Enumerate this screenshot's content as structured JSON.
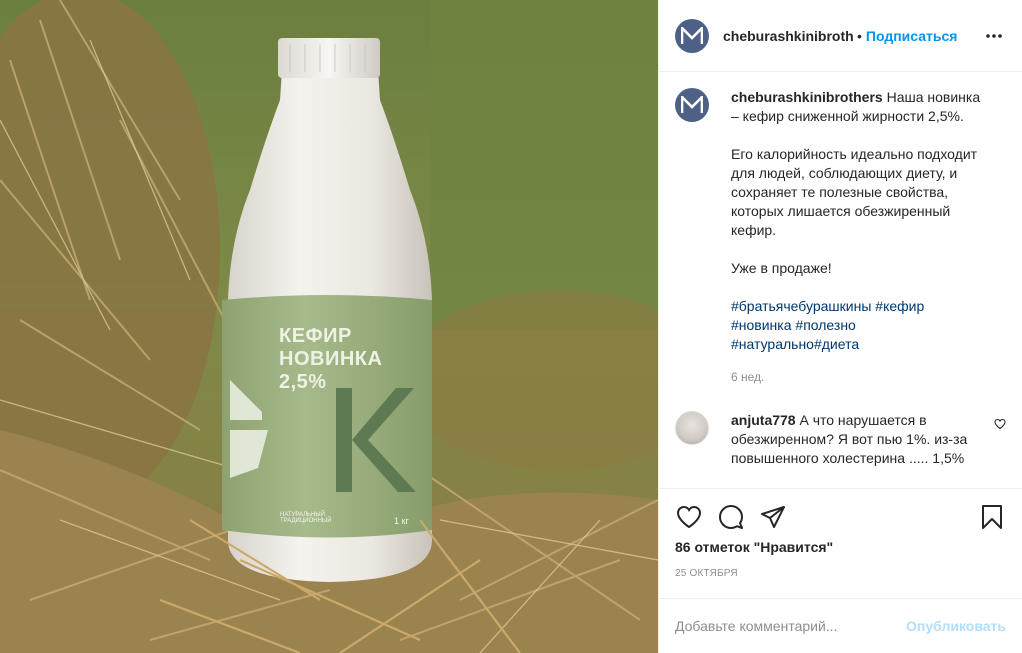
{
  "photo": {
    "alt_label": {
      "line1": "КЕФИР",
      "line2": "НОВИНКА",
      "line3": "2,5%",
      "weight": "1 кг",
      "small": "НАТУРАЛЬНЫЙ ТРАДИЦИОННЫЙ",
      "big_letter": "К"
    }
  },
  "header": {
    "username": "cheburashkinibrothers",
    "dot": "•",
    "follow_label": "Подписаться",
    "more_icon": "more-horizontal-icon"
  },
  "caption": {
    "username": "cheburashkinibrothers",
    "text1": "Наша новинка – кефир сниженной жирности 2,5%.",
    "text2": "Его калорийность идеально подходит для людей, соблюдающих диету, и сохраняет те полезные свойства, которых лишается обезжиренный кефир.",
    "text3": "Уже в продаже!",
    "hashtags": [
      "#братьячебурашкины",
      "#кефир",
      "#новинка",
      "#полезно",
      "#натурально",
      "#диета"
    ],
    "time": "6 нед."
  },
  "comment": {
    "username": "anjuta778",
    "text": "А что нарушается в обезжиренном? Я вот пью 1%. из-за повышенного холестерина ..... 1,5%"
  },
  "actions": {
    "likes": "86 отметок \"Нравится\"",
    "date": "25 октября",
    "icons": [
      "heart-icon",
      "comment-icon",
      "share-icon",
      "bookmark-icon"
    ]
  },
  "add_comment": {
    "placeholder": "Добавьте комментарий...",
    "publish_label": "Опубликовать"
  },
  "colors": {
    "accent": "#0095f6",
    "avatar_bg": "#4e6086",
    "label_green": "#9bb081",
    "letter_green": "#5d7a52"
  }
}
